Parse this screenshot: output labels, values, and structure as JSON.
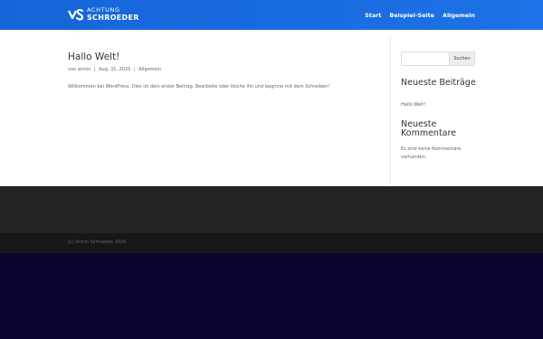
{
  "header": {
    "logo_line1": "ACHTUNG",
    "logo_line2": "SCHROEDER",
    "nav": [
      "Start",
      "Beispiel-Seite",
      "Allgemein"
    ]
  },
  "post": {
    "title": "Hallo Welt!",
    "meta_prefix": "von",
    "author": "armin",
    "date": "Aug. 31, 2025",
    "category": "Allgemein",
    "meta_separator": "|",
    "body": "Willkommen bei WordPress. Dies ist dein erster Beitrag. Bearbeite oder lösche ihn und beginne mit dem Schreiben!"
  },
  "sidebar": {
    "search_placeholder": "",
    "search_button": "Suchen",
    "recent_posts_title": "Neueste Beiträge",
    "recent_posts": [
      "Hallo Welt!"
    ],
    "recent_comments_title": "Neueste Kommentare",
    "recent_comments_empty": "Es sind keine Kommentare vorhanden."
  },
  "footer": {
    "copyright": "(c) Armin Schroeder 2025"
  },
  "colors": {
    "header": "#1565d8",
    "footer_widgets": "#222222",
    "footer_bottom": "#171717",
    "page_below": "#0e0430"
  }
}
